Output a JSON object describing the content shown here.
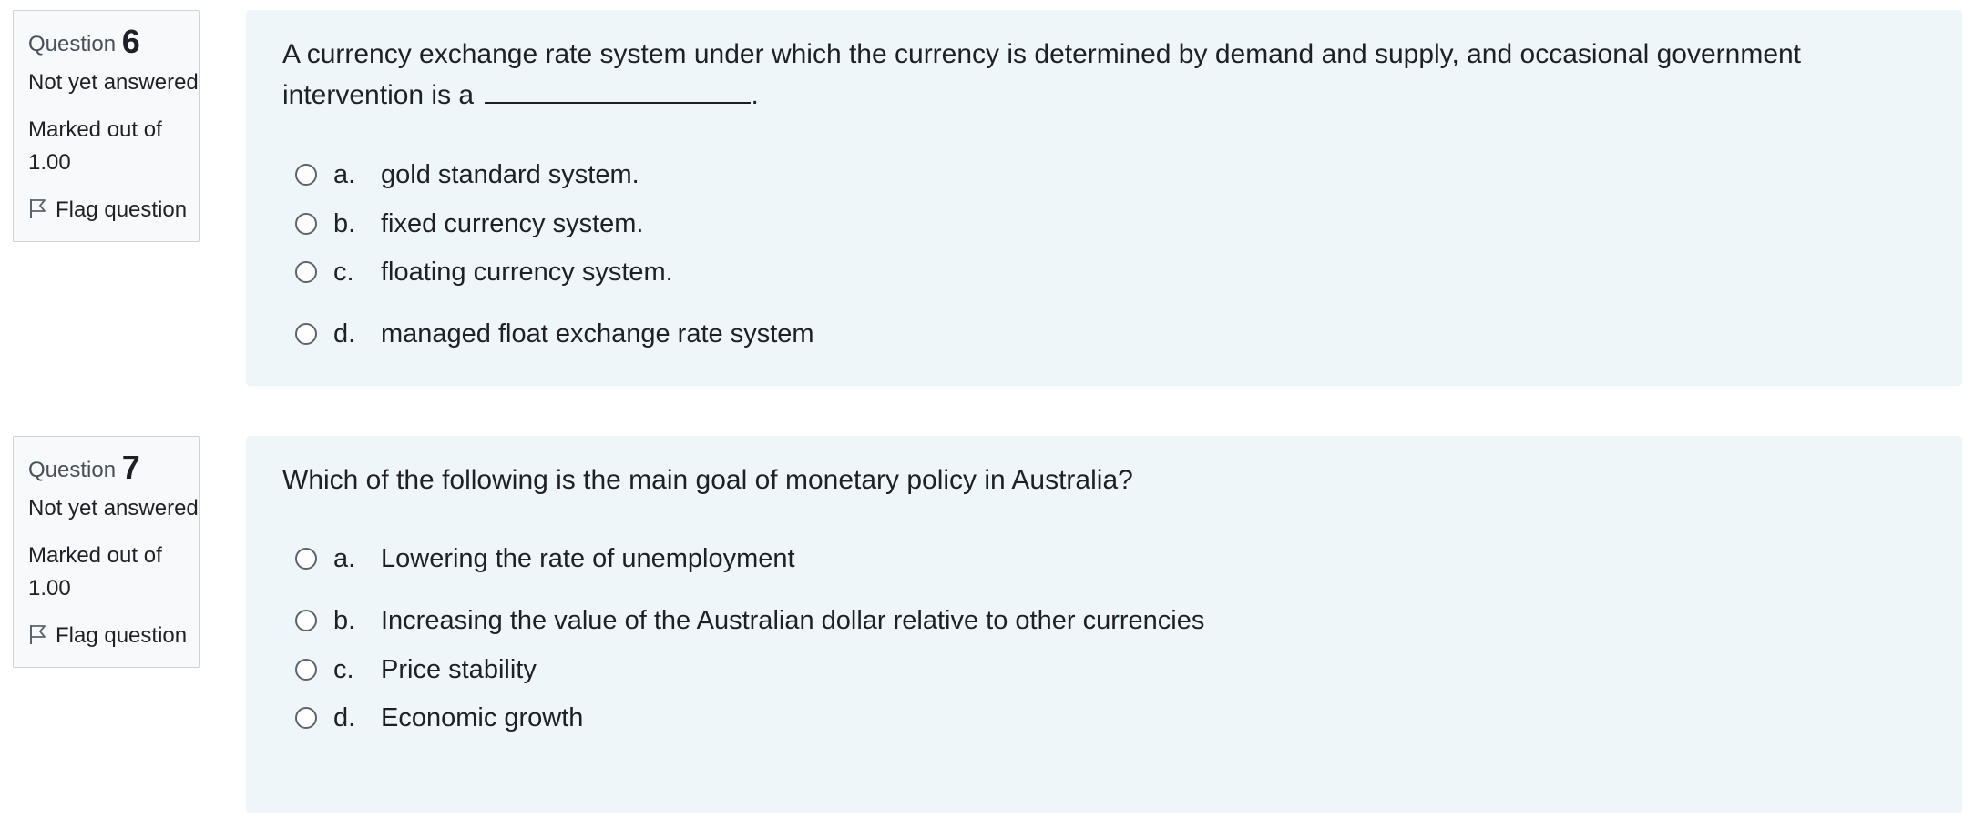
{
  "questions": [
    {
      "question_word": "Question",
      "number": "6",
      "state": "Not yet answered",
      "grade": "Marked out of 1.00",
      "flag_label": "Flag question",
      "text_before_blank": "A currency exchange rate system under which the currency is determined by demand and supply, and occasional government intervention is a",
      "text_after_blank": ".",
      "options": [
        {
          "letter": "a.",
          "text": "gold standard system."
        },
        {
          "letter": "b.",
          "text": "fixed currency system."
        },
        {
          "letter": "c.",
          "text": "floating currency system."
        },
        {
          "letter": "d.",
          "text": "managed float exchange rate system"
        }
      ]
    },
    {
      "question_word": "Question",
      "number": "7",
      "state": "Not yet answered",
      "grade": "Marked out of 1.00",
      "flag_label": "Flag question",
      "text": "Which of the following is the main goal of monetary policy in Australia?",
      "options": [
        {
          "letter": "a.",
          "text": "Lowering the rate of unemployment"
        },
        {
          "letter": "b.",
          "text": "Increasing the value of the Australian dollar relative to other currencies"
        },
        {
          "letter": "c.",
          "text": "Price stability"
        },
        {
          "letter": "d.",
          "text": "Economic growth"
        }
      ]
    }
  ],
  "colors": {
    "content_background": "#eff6fa",
    "info_background": "#f8f9fa",
    "info_border": "#cfd3d7",
    "text": "#1d2125"
  },
  "icons": {
    "flag": "flag-icon",
    "radio": "radio-button-empty"
  }
}
